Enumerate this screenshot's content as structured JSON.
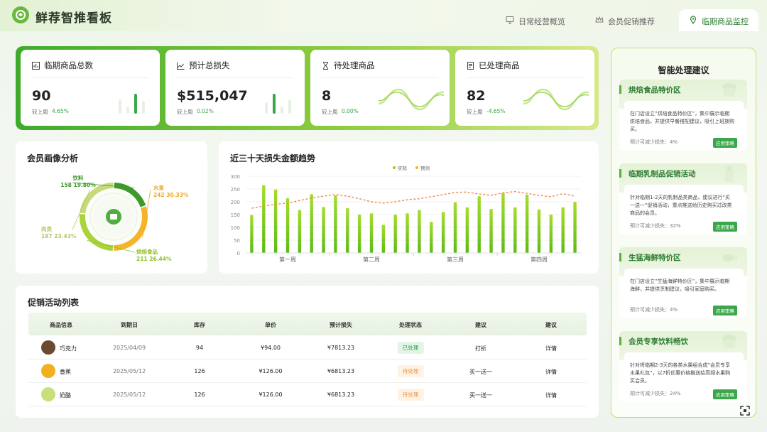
{
  "header": {
    "title": "鲜荐智推看板",
    "tabs": [
      {
        "label": "日常经营概览",
        "icon": "monitor-icon",
        "active": false
      },
      {
        "label": "会员促销推荐",
        "icon": "crown-icon",
        "active": false
      },
      {
        "label": "临期商品监控",
        "icon": "location-pin-icon",
        "active": true
      }
    ]
  },
  "kpis": [
    {
      "title": "临期商品总数",
      "icon": "bar-chart-icon",
      "value": "90",
      "compare_label": "较上周",
      "change": "4.65%"
    },
    {
      "title": "预计总损失",
      "icon": "area-chart-icon",
      "value": "$515,047",
      "compare_label": "较上周",
      "change": "0.02%"
    },
    {
      "title": "待处理商品",
      "icon": "hourglass-icon",
      "value": "8",
      "compare_label": "较上周",
      "change": "0.00%"
    },
    {
      "title": "已处理商品",
      "icon": "document-icon",
      "value": "82",
      "compare_label": "较上周",
      "change": "-4.65%"
    }
  ],
  "member_panel": {
    "title": "会员画像分析"
  },
  "trend_panel": {
    "title": "近三十天损失金额趋势"
  },
  "table": {
    "title": "促销活动列表",
    "columns": [
      "商品信息",
      "到期日",
      "库存",
      "单价",
      "预计损失",
      "处理状态",
      "建议",
      "建议"
    ],
    "rows": [
      {
        "name": "巧克力",
        "date": "2025/04/09",
        "stock": "94",
        "price": "¥94.00",
        "loss": "¥7813.23",
        "status": "已处理",
        "status_type": "done",
        "suggestion": "打折",
        "detail": "详情",
        "img_color": "#6b4a32"
      },
      {
        "name": "香蕉",
        "date": "2025/05/12",
        "stock": "126",
        "price": "¥126.00",
        "loss": "¥6813.23",
        "status": "待处理",
        "status_type": "todo",
        "suggestion": "买一送一",
        "detail": "详情",
        "img_color": "#f0b020"
      },
      {
        "name": "奶酪",
        "date": "2025/05/12",
        "stock": "126",
        "price": "¥126.00",
        "loss": "¥6813.23",
        "status": "待处理",
        "status_type": "todo",
        "suggestion": "买一送一",
        "detail": "详情",
        "img_color": "#c9e07a"
      }
    ]
  },
  "sidebar": {
    "title": "智能处理建议",
    "cards": [
      {
        "title": "烘焙食品特价区",
        "text": "在门店设立”烘焙食品特价区”，集中展示临期烘焙食品，并提供早餐搭配建议，吸引上班族购买。",
        "saving_label": "预计可减少损失：",
        "saving": "4%",
        "button": "应用策略",
        "icon": "cake-icon"
      },
      {
        "title": "临期乳制品促销活动",
        "text": "针对临期1-2天的乳制品类商品，建议进行”买一送一”促销活动，重点推送给历史购买过改类商品的会员。",
        "saving_label": "预计可减少损失：",
        "saving": "32%",
        "button": "应用策略",
        "icon": "milk-bottle-icon"
      },
      {
        "title": "生猛海鲜特价区",
        "text": "在门店设立”生猛海鲜特价区”，集中展示临期海鲜，并提供烹制建议，吸引家庭购买。",
        "saving_label": "预计可减少损失：",
        "saving": "4%",
        "button": "应用策略",
        "icon": "fish-icon"
      },
      {
        "title": "会员专享饮料畅饮",
        "text": "针对将临期2-3天的各类水果组合成”会员专享水果礼包”，以7折优惠价格推送给高频水果购买会员。",
        "saving_label": "预计可减少损失：",
        "saving": "24%",
        "button": "应用策略",
        "icon": "cake-icon"
      }
    ]
  },
  "colors": {
    "primary": "#3aa84a",
    "lime": "#8fcf2e",
    "orange": "#f2b32c",
    "dashed": "#f08a4b"
  },
  "chart_data": [
    {
      "type": "pie",
      "title": "会员画像分析",
      "labels": [
        "饮料",
        "水果",
        "烘焙食品",
        "肉类"
      ],
      "counts": [
        158,
        242,
        211,
        187
      ],
      "values": [
        19.8,
        30.33,
        26.44,
        23.43
      ],
      "value_labels": [
        "158  19.80%",
        "242  30.33%",
        "211  26.44%",
        "187  23.43%"
      ],
      "colors": [
        "#3d9a2a",
        "#f4b52b",
        "#a8d43a",
        "#c7d97b"
      ]
    },
    {
      "type": "bar",
      "title": "近三十天损失金额趋势",
      "ylim": [
        0,
        300
      ],
      "yticks": [
        0,
        50,
        100,
        150,
        200,
        250,
        300
      ],
      "x_labels": [
        "第一周",
        "第二周",
        "第三周",
        "第四周"
      ],
      "legend": "top-center",
      "series": [
        {
          "name": "实际",
          "kind": "bar",
          "values": [
            148,
            265,
            248,
            214,
            168,
            230,
            180,
            225,
            175,
            150,
            155,
            110,
            150,
            155,
            168,
            122,
            160,
            198,
            178,
            222,
            172,
            235,
            178,
            228,
            170,
            150,
            178,
            200
          ]
        },
        {
          "name": "预测",
          "kind": "dashed-line",
          "values": [
            175,
            183,
            190,
            195,
            205,
            215,
            222,
            228,
            222,
            212,
            200,
            195,
            200,
            208,
            212,
            220,
            228,
            237,
            238,
            230,
            225,
            235,
            240,
            233,
            225,
            220,
            232,
            222
          ]
        }
      ]
    }
  ]
}
